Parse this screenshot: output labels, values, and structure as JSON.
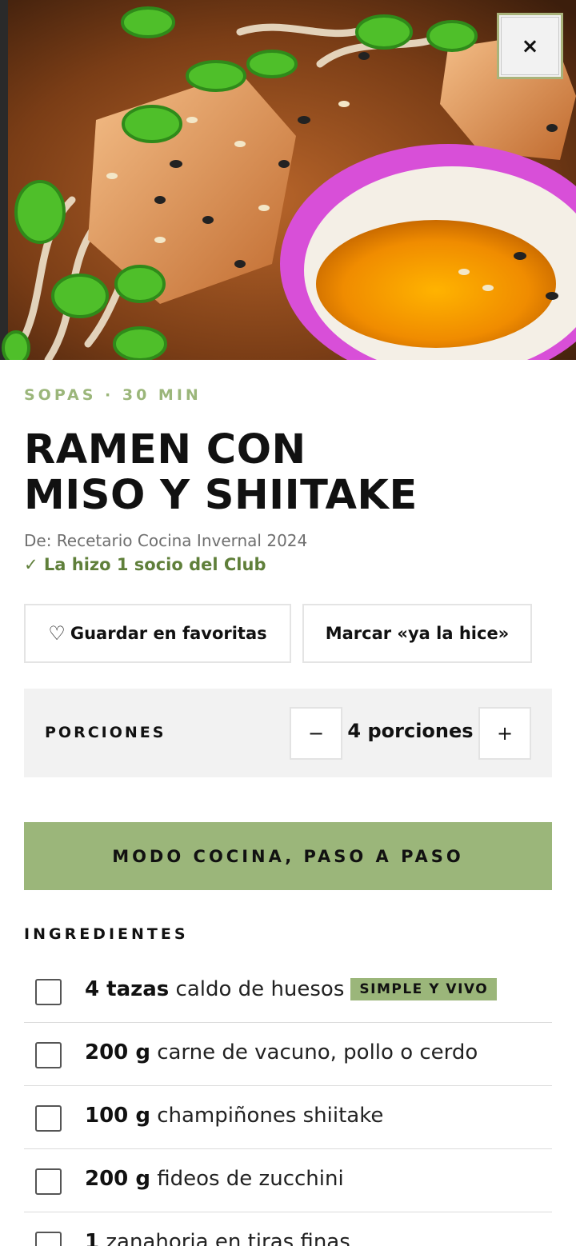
{
  "close_button": {
    "label": "×"
  },
  "recipe": {
    "meta": "SOPAS · 30 MIN",
    "title_line1": "RAMEN CON",
    "title_line2": "MISO Y SHIITAKE",
    "source": "De: Recetario Cocina Invernal 2024",
    "made_by": "✓ La hizo 1 socio del Club"
  },
  "actions": {
    "favorite_icon": "♡",
    "favorite_label": "Guardar en favoritas",
    "made_label": "Marcar «ya la hice»"
  },
  "servings": {
    "label": "PORCIONES",
    "minus": "−",
    "value": "4 porciones",
    "plus": "+"
  },
  "cook_mode": {
    "label": "MODO COCINA, PASO A PASO"
  },
  "ingredients": {
    "heading": "INGREDIENTES",
    "items": [
      {
        "qty": "4 tazas",
        "name": " caldo de huesos",
        "badge": "SIMPLE Y VIVO"
      },
      {
        "qty": "200 g",
        "name": " carne de vacuno, pollo o cerdo"
      },
      {
        "qty": "100 g",
        "name": " champiñones shiitake"
      },
      {
        "qty": "200 g",
        "name": " fideos de zucchini"
      },
      {
        "qty": "1",
        "name": " zanahoria en tiras finas"
      }
    ]
  },
  "colors": {
    "accent": "#9bb67a",
    "made_text": "#5f7f3a"
  }
}
